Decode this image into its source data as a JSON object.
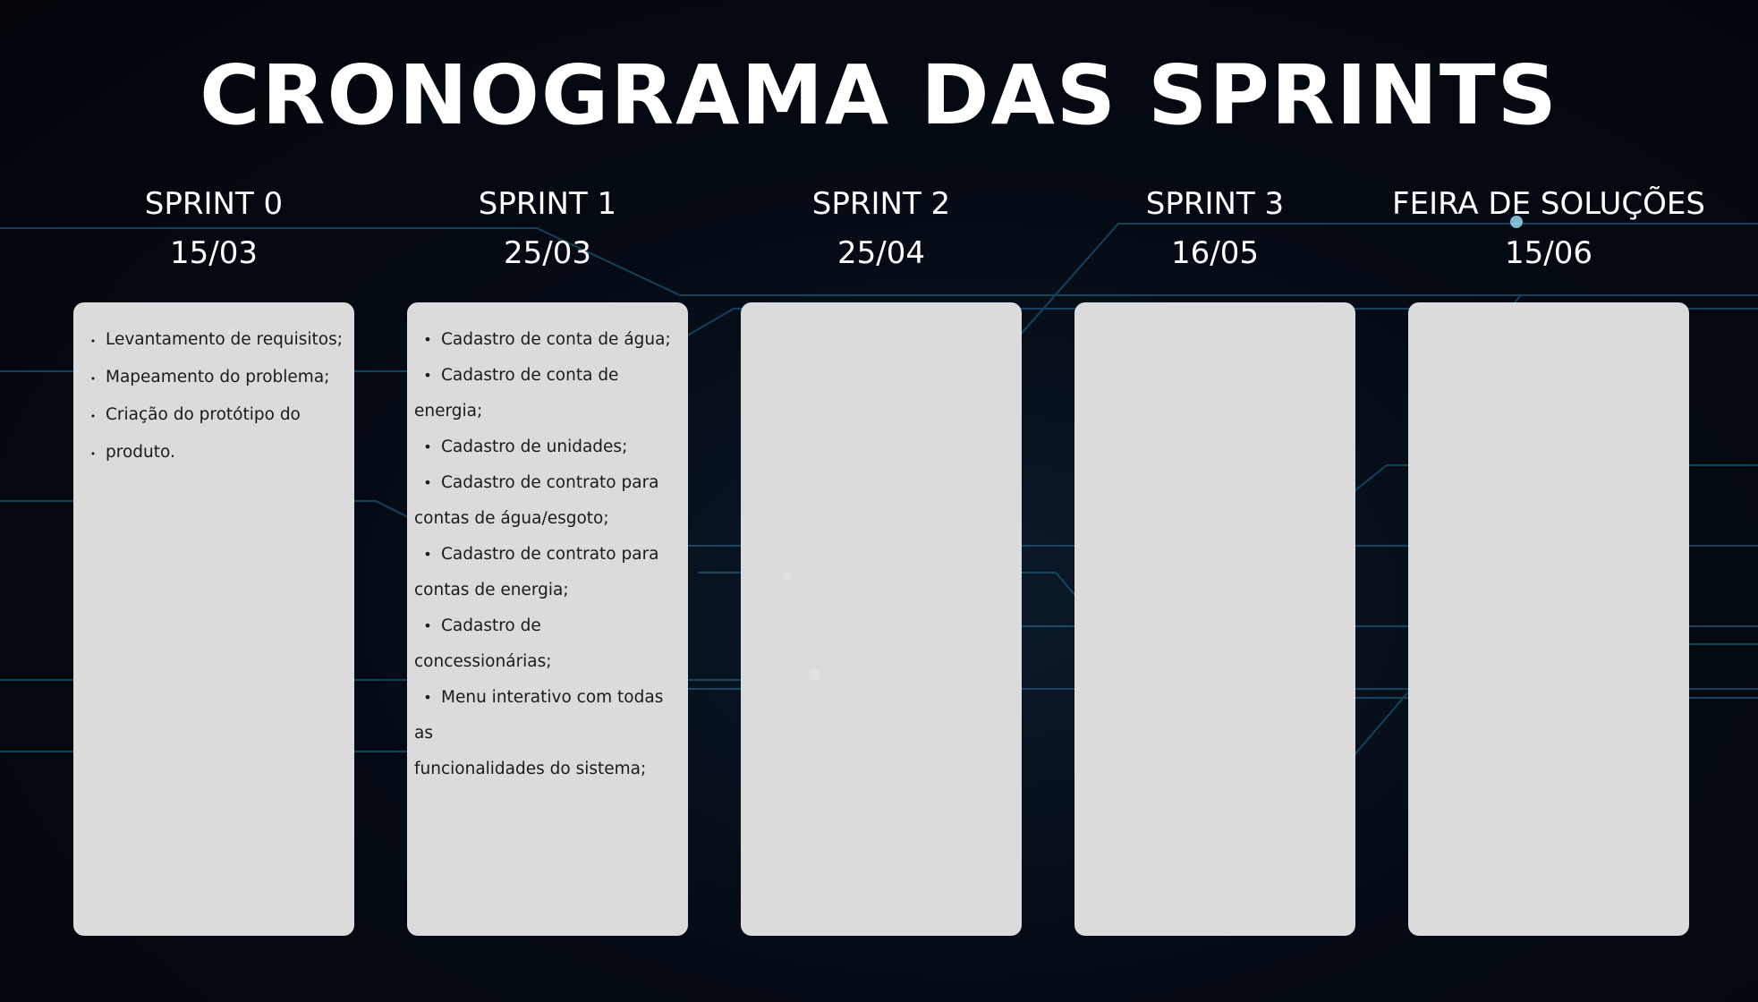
{
  "title": "CRONOGRAMA DAS SPRINTS",
  "sprints": [
    {
      "name": "SPRINT 0",
      "date": "15/03",
      "items": [
        "Levantamento de requisitos;",
        "Mapeamento do problema;",
        "Criação do protótipo do",
        "produto."
      ]
    },
    {
      "name": "SPRINT 1",
      "date": "25/03",
      "items": [
        "Cadastro de conta de água;",
        "Cadastro de conta de energia;",
        "Cadastro de unidades;",
        "Cadastro de contrato para",
        "contas de água/esgoto;",
        "Cadastro de contrato para",
        "contas de energia;",
        "Cadastro de concessionárias;",
        "Menu interativo com todas as",
        "funcionalidades do sistema;"
      ]
    },
    {
      "name": "SPRINT 2",
      "date": "25/04",
      "items": []
    },
    {
      "name": "SPRINT 3",
      "date": "16/05",
      "items": []
    },
    {
      "name": "FEIRA DE SOLUÇÕES",
      "date": "15/06",
      "items": []
    }
  ],
  "colors": {
    "background": "#03060c",
    "card": "#e2e2e2",
    "text_light": "#ffffff",
    "text_dark": "#1a1a1a"
  }
}
